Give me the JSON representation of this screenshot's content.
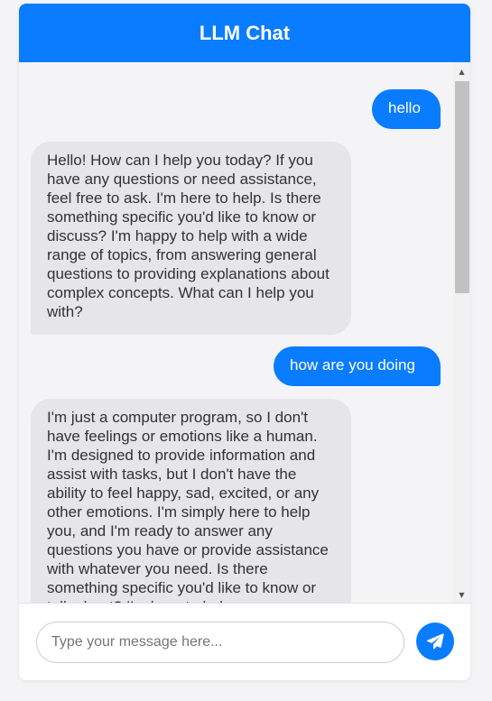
{
  "header": {
    "title": "LLM Chat"
  },
  "messages": [
    {
      "role": "user",
      "text": "hello"
    },
    {
      "role": "bot",
      "text": "Hello! How can I help you today? If you have any questions or need assistance, feel free to ask. I'm here to help. Is there something specific you'd like to know or discuss? I'm happy to help with a wide range of topics, from answering general questions to providing explanations about complex concepts. What can I help you with?"
    },
    {
      "role": "user",
      "text": "how are you doing"
    },
    {
      "role": "bot",
      "text": "I'm just a computer program, so I don't have feelings or emotions like a human. I'm designed to provide information and assist with tasks, but I don't have the ability to feel happy, sad, excited, or any other emotions. I'm simply here to help you, and I'm ready to answer any questions you have or provide assistance with whatever you need. Is there something specific you'd like to know or talk about? I'm here to help."
    }
  ],
  "composer": {
    "placeholder": "Type your message here...",
    "value": ""
  },
  "icons": {
    "send": "paper-plane-icon",
    "scroll_up": "arrow-up-icon",
    "scroll_down": "arrow-down-icon"
  },
  "colors": {
    "accent": "#0a7cff",
    "bot_bubble": "#e5e5ea",
    "messages_bg": "#f4f4f6"
  }
}
